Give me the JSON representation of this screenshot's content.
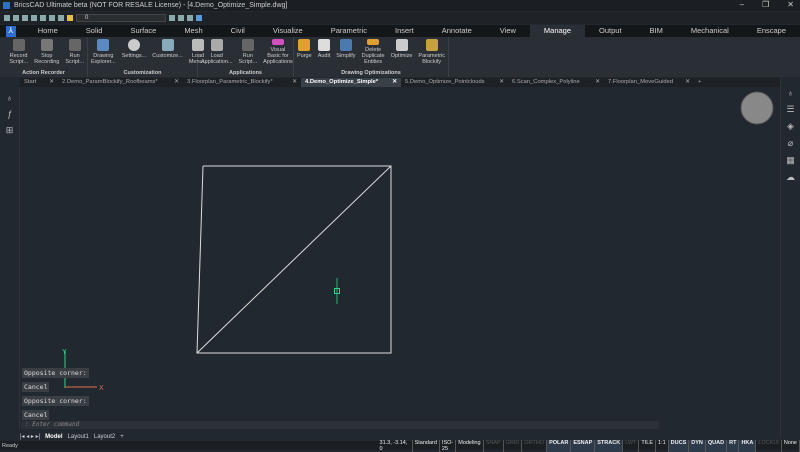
{
  "title": "BricsCAD Ultimate beta (NOT FOR RESALE License) - [4.Demo_Optimize_Simple.dwg]",
  "window_controls": [
    "–",
    "❐",
    "✕"
  ],
  "layer_value": "0",
  "ribbon_tabs": [
    "Home",
    "Solid",
    "Surface",
    "Mesh",
    "Civil",
    "Visualize",
    "Parametric",
    "Insert",
    "Annotate",
    "View",
    "Manage",
    "Output",
    "BIM",
    "Mechanical",
    "Enscape"
  ],
  "active_tab": "Manage",
  "groups": [
    {
      "label": "Action Recorder",
      "buttons": [
        "Record Script...",
        "Stop Recording",
        "Run Script..."
      ]
    },
    {
      "label": "Customization",
      "buttons": [
        "Drawing Explorer...",
        "Settings...",
        "Customize...",
        "Load Menu..."
      ]
    },
    {
      "label": "Applications",
      "buttons": [
        "Load Application...",
        "Run Script...",
        "Visual Basic for Applications"
      ]
    },
    {
      "label": "Drawing Optimizations",
      "buttons": [
        "Purge",
        "Audit",
        "Simplify",
        "Delete Duplicate Entities",
        "Optimize",
        "Parametric Blockify"
      ]
    }
  ],
  "doc_tabs": [
    "Start",
    "2.Demo_ParamBlockify_Roofbeams*",
    "3.Floorplan_Parametric_Blockify*",
    "4.Demo_Optimize_Simple*",
    "5.Demo_Optimize_Pointclouds",
    "6.Scan_Complex_Polyline",
    "7.Floorplan_MoveGuided"
  ],
  "active_doc": 3,
  "command_history": [
    "Opposite corner:",
    "Cancel",
    "Opposite corner:",
    "Cancel"
  ],
  "command_placeholder": ": Enter command",
  "axis": {
    "x": "X",
    "y": "Y"
  },
  "layout_tabs": [
    "Model",
    "Layout1",
    "Layout2",
    "+"
  ],
  "status": {
    "ready": "Ready",
    "coords": "31.3, -3.14, 0",
    "items": [
      {
        "t": "Standard",
        "s": "n"
      },
      {
        "t": "ISO-25",
        "s": "n"
      },
      {
        "t": "Modeling",
        "s": "n"
      },
      {
        "t": "SNAP",
        "s": "off"
      },
      {
        "t": "GRID",
        "s": "off"
      },
      {
        "t": "ORTHO",
        "s": "off"
      },
      {
        "t": "POLAR",
        "s": "on"
      },
      {
        "t": "ESNAP",
        "s": "on"
      },
      {
        "t": "STRACK",
        "s": "on"
      },
      {
        "t": "LWT",
        "s": "off"
      },
      {
        "t": "TILE",
        "s": "n"
      },
      {
        "t": "1:1",
        "s": "n"
      },
      {
        "t": "DUCS",
        "s": "on"
      },
      {
        "t": "DYN",
        "s": "on"
      },
      {
        "t": "QUAD",
        "s": "on"
      },
      {
        "t": "RT",
        "s": "on"
      },
      {
        "t": "HKA",
        "s": "on"
      },
      {
        "t": "LOCKUI",
        "s": "off"
      },
      {
        "t": "None",
        "s": "n"
      }
    ]
  }
}
